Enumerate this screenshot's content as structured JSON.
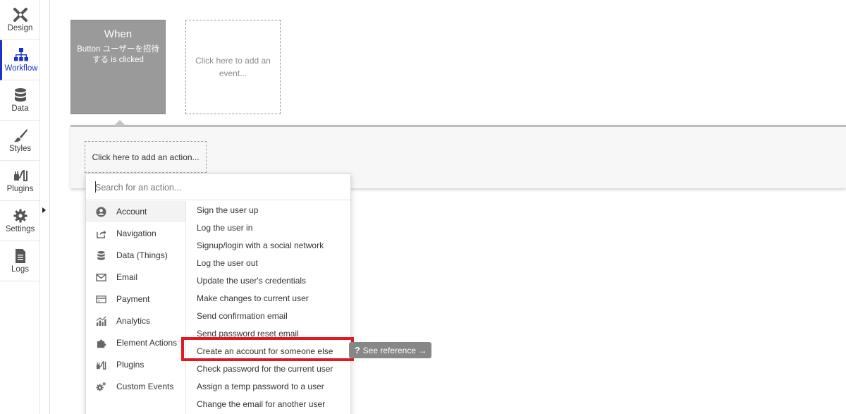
{
  "nav": {
    "items": [
      {
        "label": "Design",
        "icon": "design-icon",
        "active": false
      },
      {
        "label": "Workflow",
        "icon": "workflow-icon",
        "active": true
      },
      {
        "label": "Data",
        "icon": "database-icon",
        "active": false
      },
      {
        "label": "Styles",
        "icon": "brush-icon",
        "active": false
      },
      {
        "label": "Plugins",
        "icon": "plug-icon",
        "active": false
      },
      {
        "label": "Settings",
        "icon": "gear-icon",
        "active": false
      },
      {
        "label": "Logs",
        "icon": "document-icon",
        "active": false
      }
    ],
    "active_color": "#1a33c6"
  },
  "workflow": {
    "event_card": {
      "title": "When",
      "description": "Button ユーザーを招待する is clicked"
    },
    "add_event_label": "Click here to add an event...",
    "add_action_label": "Click here to add an action..."
  },
  "action_picker": {
    "search_placeholder": "Search for an action...",
    "categories": [
      {
        "label": "Account",
        "icon": "user-circle-icon",
        "active": true
      },
      {
        "label": "Navigation",
        "icon": "share-arrow-icon",
        "active": false
      },
      {
        "label": "Data (Things)",
        "icon": "database-icon",
        "active": false
      },
      {
        "label": "Email",
        "icon": "envelope-icon",
        "active": false
      },
      {
        "label": "Payment",
        "icon": "credit-card-icon",
        "active": false
      },
      {
        "label": "Analytics",
        "icon": "bar-chart-icon",
        "active": false
      },
      {
        "label": "Element Actions",
        "icon": "puzzle-icon",
        "active": false
      },
      {
        "label": "Plugins",
        "icon": "plug-icon",
        "active": false
      },
      {
        "label": "Custom Events",
        "icon": "gears-icon",
        "active": false
      }
    ],
    "actions": [
      "Sign the user up",
      "Log the user in",
      "Signup/login with a social network",
      "Log the user out",
      "Update the user's credentials",
      "Make changes to current user",
      "Send confirmation email",
      "Send password reset email",
      "Create an account for someone else",
      "Check password for the current user",
      "Assign a temp password to a user",
      "Change the email for another user"
    ],
    "highlighted_action_index": 8,
    "see_reference_label": "See reference →",
    "highlight_color": "#e01a22"
  }
}
